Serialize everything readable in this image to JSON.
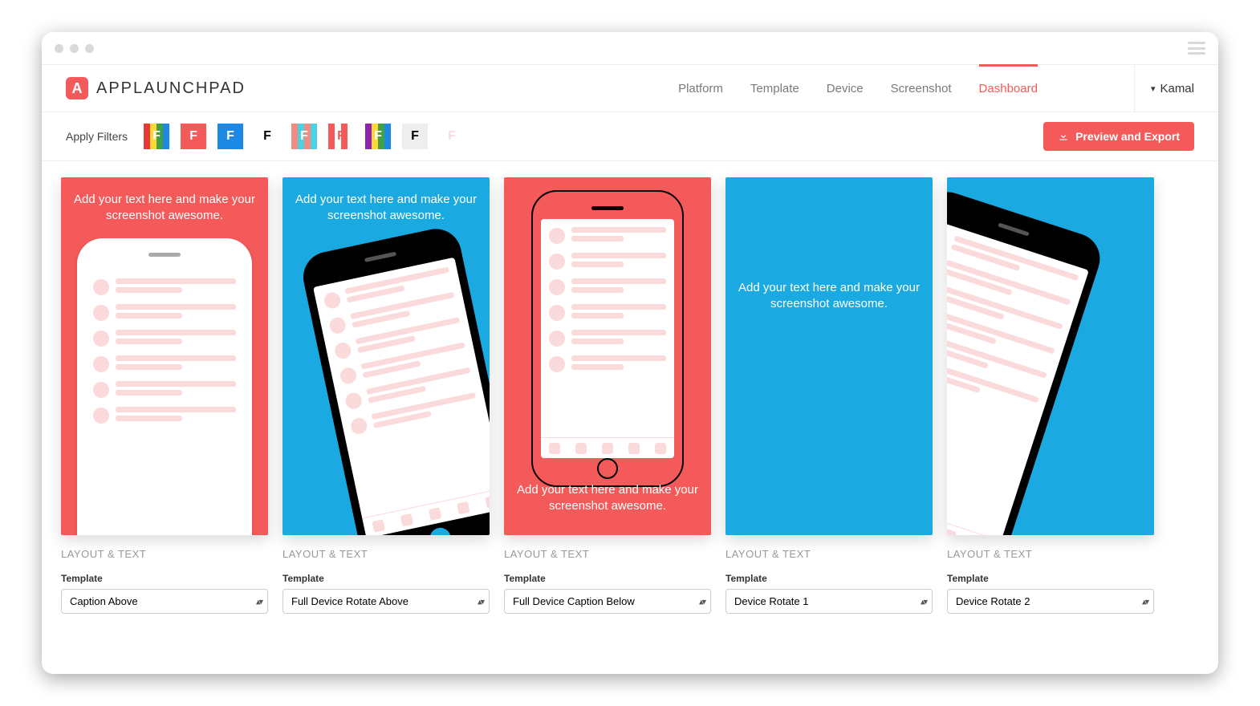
{
  "header": {
    "brand_letter": "A",
    "brand_name": "APPLAUNCHPAD",
    "nav_items": [
      "Platform",
      "Template",
      "Device",
      "Screenshot",
      "Dashboard"
    ],
    "active_nav": "Dashboard",
    "user_name": "Kamal"
  },
  "toolbar": {
    "filters_label": "Apply Filters",
    "preview_export_label": "Preview and Export",
    "filter_swatches": [
      {
        "bg": [
          "#e53935",
          "#fdd835",
          "#43a047",
          "#1e88e5"
        ],
        "letter_color": "#fff"
      },
      {
        "bg": [
          "#f55a5a",
          "#f55a5a",
          "#f55a5a",
          "#f55a5a"
        ],
        "letter_color": "#fff"
      },
      {
        "bg": [
          "#1e88e5",
          "#1e88e5",
          "#1e88e5",
          "#1e88e5"
        ],
        "letter_color": "#fff"
      },
      {
        "bg": [
          "#ffffff",
          "#ffffff",
          "#ffffff",
          "#ffffff"
        ],
        "letter_color": "#000"
      },
      {
        "bg": [
          "#f28b82",
          "#4dd0e1",
          "#f28b82",
          "#4dd0e1"
        ],
        "letter_color": "#fff"
      },
      {
        "bg": [
          "#f55a5a",
          "#ffffff",
          "#f55a5a",
          "#ffffff"
        ],
        "letter_color": "#f55a5a"
      },
      {
        "bg": [
          "#8e24aa",
          "#fdd835",
          "#43a047",
          "#1e88e5"
        ],
        "letter_color": "#fff"
      },
      {
        "bg": [
          "#eeeeee",
          "#eeeeee",
          "#eeeeee",
          "#eeeeee"
        ],
        "letter_color": "#000"
      },
      {
        "bg": [
          "#ffffff",
          "#ffffff",
          "#ffffff",
          "#ffffff"
        ],
        "letter_color": "#fadadb"
      }
    ]
  },
  "cards": [
    {
      "bg": "#f55a5a",
      "text": "Add your text here and make your screenshot awesome.",
      "text_pos": "top",
      "phone_style": "white-upright"
    },
    {
      "bg": "#1ba9e1",
      "text": "Add your text here and make your screenshot awesome.",
      "text_pos": "top",
      "phone_style": "black-rotate-left"
    },
    {
      "bg": "#f55a5a",
      "text": "Add your text here and make your screenshot awesome.",
      "text_pos": "bottom",
      "phone_style": "outline-upright"
    },
    {
      "bg": "#1ba9e1",
      "text": "Add your text here and make your screenshot awesome.",
      "text_pos": "middle",
      "phone_style": "none"
    },
    {
      "bg": "#1ba9e1",
      "text": "",
      "text_pos": "none",
      "phone_style": "black-rotate-right"
    }
  ],
  "controls": {
    "section_title": "LAYOUT & TEXT",
    "template_label": "Template",
    "templates": [
      "Caption Above",
      "Full Device Rotate Above",
      "Full Device Caption Below",
      "Device Rotate 1",
      "Device Rotate 2"
    ]
  }
}
